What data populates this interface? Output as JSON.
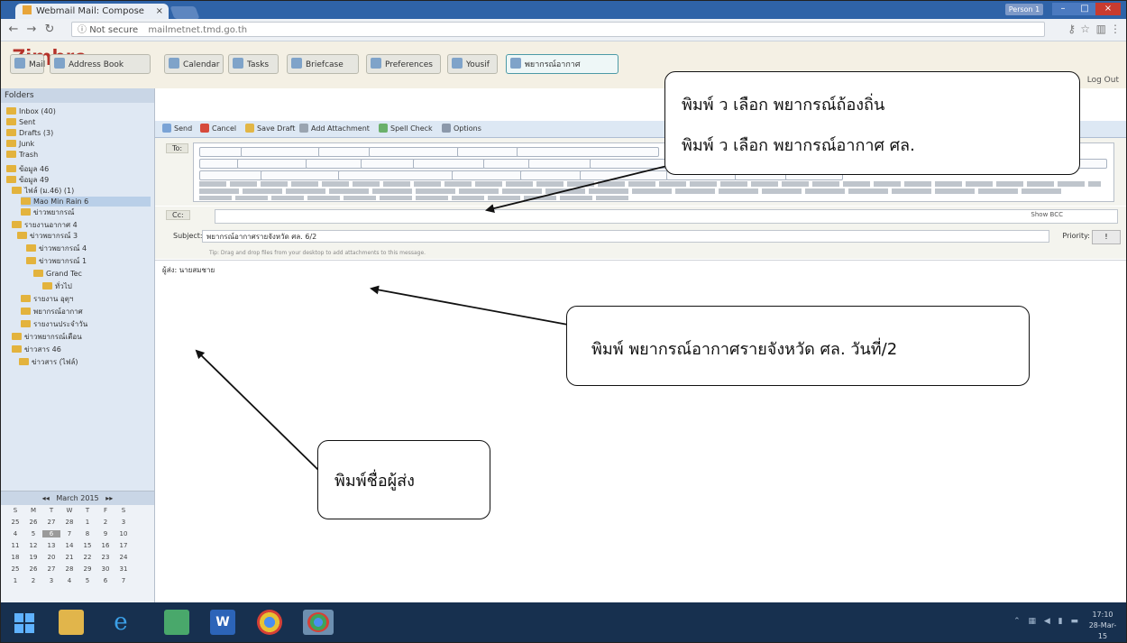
{
  "browser": {
    "tab_title": "Webmail Mail: Compose",
    "address_security": "Not secure",
    "address_url": "mailmetnet.tmd.go.th",
    "user_chip": "Person 1"
  },
  "zimbra": {
    "logo": "Zimbra",
    "logout": "Log Out",
    "app_tabs": [
      "Mail",
      "Address Book",
      "Calendar",
      "Tasks",
      "Briefcase",
      "Preferences",
      "Yousif",
      "พยากรณ์อากาศ"
    ]
  },
  "folders": {
    "header": "Folders",
    "items": [
      "Inbox (40)",
      "Sent",
      "Drafts (3)",
      "Junk",
      "Trash",
      "ข้อมูล 46",
      "ข้อมูล 49",
      "ไฟล์ (ม.46) (1)",
      "Mao Min Rain 6",
      "ข่าวพยากรณ์",
      "รายงานอากาศ 4",
      "ข่าวพยากรณ์ 3",
      "ข่าวพยากรณ์ 4",
      "ข่าวพยากรณ์ 1",
      "Grand Tec",
      "ทั่วไป",
      "รายงาน อุตุฯ",
      "พยากรณ์อากาศ",
      "รายงานประจำวัน",
      "ข่าวพยากรณ์เตือน",
      "ข่าวสาร 46",
      "ข่าวสาร (ไฟล์)"
    ],
    "calendar_header": "March 2015",
    "calendar_rows": [
      [
        "S",
        "M",
        "T",
        "W",
        "T",
        "F",
        "S"
      ],
      [
        "25",
        "26",
        "27",
        "28",
        "1",
        "2",
        "3"
      ],
      [
        "4",
        "5",
        "6",
        "7",
        "8",
        "9",
        "10"
      ],
      [
        "11",
        "12",
        "13",
        "14",
        "15",
        "16",
        "17"
      ],
      [
        "18",
        "19",
        "20",
        "21",
        "22",
        "23",
        "24"
      ],
      [
        "25",
        "26",
        "27",
        "28",
        "29",
        "30",
        "31"
      ],
      [
        "1",
        "2",
        "3",
        "4",
        "5",
        "6",
        "7"
      ]
    ]
  },
  "compose": {
    "toolbar": [
      "Send",
      "Cancel",
      "Save Draft",
      "Add Attachment",
      "Spell Check",
      "Options"
    ],
    "to_label": "To:",
    "cc_label": "Cc:",
    "show_bcc": "Show BCC",
    "subject_label": "Subject:",
    "subject_value": "พยากรณ์อากาศรายจังหวัด ศล. 6/2",
    "priority_label": "Priority:",
    "priority_value": "!",
    "tip": "Tip: Drag and drop files from your desktop to add attachments to this message.",
    "body_text": "ผู้ส่ง: นายสมชาย"
  },
  "taskbar": {
    "clock_time": "17:10",
    "clock_date": "28-Mar-15"
  },
  "annotations": {
    "forecast_line1": "พิมพ์ ว เลือก พยากรณ์ถ้องถิ่น",
    "forecast_line2": "พิมพ์ ว เลือก พยากรณ์อากาศ ศล.",
    "subject_note": "พิมพ์ พยากรณ์อากาศรายจังหวัด ศล. วันที่/2",
    "sender_note": "พิมพ์ชื่อผู้ส่ง"
  }
}
